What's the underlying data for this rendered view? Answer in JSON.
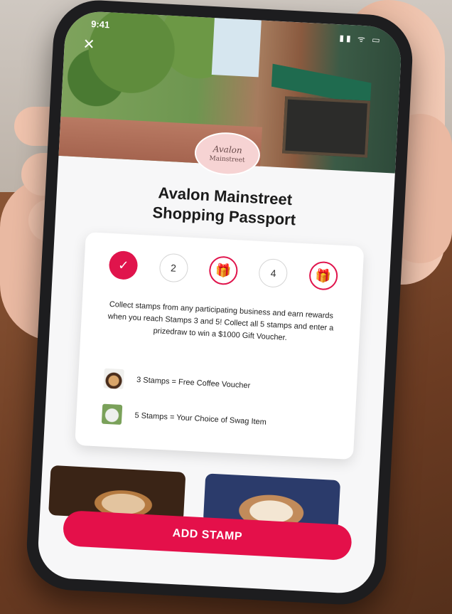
{
  "status_bar": {
    "time": "9:41",
    "icons": "▮▮ ᯤ ▭"
  },
  "header": {
    "back_icon": "x-icon"
  },
  "badge": {
    "line1": "Avalon",
    "line2": "Mainstreet"
  },
  "title": {
    "line1": "Avalon Mainstreet",
    "line2": "Shopping Passport"
  },
  "stamps": [
    {
      "type": "done",
      "label": "✓"
    },
    {
      "type": "num",
      "label": "2"
    },
    {
      "type": "gift",
      "label": "🎁"
    },
    {
      "type": "num",
      "label": "4"
    },
    {
      "type": "gift",
      "label": "🎁"
    }
  ],
  "description": "Collect stamps from any participating business and earn rewards when you reach Stamps 3 and 5! Collect all 5 stamps and enter a prizedraw to win a $1000 Gift Voucher.",
  "rewards": [
    {
      "text": "3 Stamps = Free Coffee Voucher"
    },
    {
      "text": "5 Stamps = Your Choice of Swag Item"
    }
  ],
  "cta": {
    "label": "ADD STAMP"
  },
  "colors": {
    "accent": "#e4104a",
    "badge_bg": "#f6d3d3"
  }
}
